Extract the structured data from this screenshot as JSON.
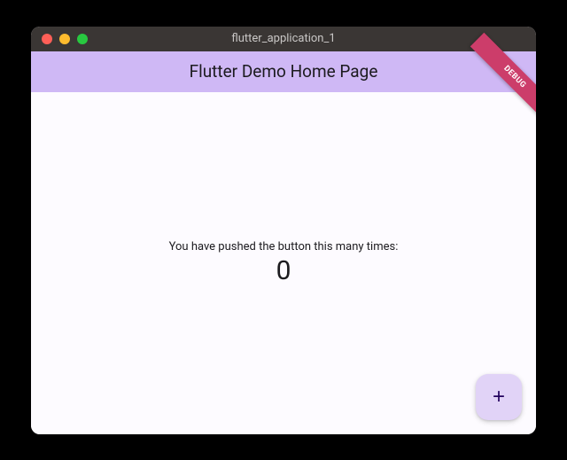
{
  "window": {
    "title": "flutter_application_1"
  },
  "appbar": {
    "title": "Flutter Demo Home Page"
  },
  "debug_banner": {
    "label": "DEBUG"
  },
  "body": {
    "message": "You have pushed the button this many times:",
    "counter": "0"
  },
  "fab": {
    "icon": "+"
  }
}
